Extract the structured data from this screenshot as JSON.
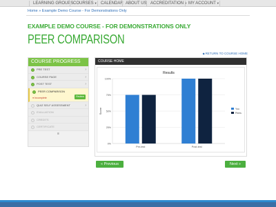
{
  "nav": {
    "items": [
      "LEARNING GROUPS",
      "COURSES",
      "CALENDAR",
      "ABOUT US",
      "ACCREDITATION",
      "MY ACCOUNT"
    ]
  },
  "breadcrumb": {
    "home": "Home",
    "separator": " » ",
    "current": "Example Demo Course - For Demonstrations Only"
  },
  "course_title": "EXAMPLE DEMO COURSE - FOR DEMONSTRATIONS ONLY",
  "page_title": "PEER COMPARISON",
  "return_link": "RETURN TO COURSE HOME",
  "sidebar": {
    "title": "COURSE PROGRESS",
    "items": [
      {
        "label": "PRE TEST",
        "state": "done"
      },
      {
        "label": "COURSE PAGE",
        "state": "done"
      },
      {
        "label": "POST TEST",
        "state": "done"
      },
      {
        "label": "PEER COMPARISON",
        "state": "active",
        "sub": "Incomplete",
        "action": "Review"
      },
      {
        "label": "QUIZ SELF ASSESSMENT",
        "state": "todo"
      },
      {
        "label": "EVALUATION",
        "state": "locked"
      },
      {
        "label": "CREDITS",
        "state": "locked"
      },
      {
        "label": "CERTIFICATE",
        "state": "locked"
      }
    ]
  },
  "main": {
    "header": "COURSE HOME"
  },
  "buttons": {
    "previous": "Previous",
    "next": "Next"
  },
  "colors": {
    "brand_green": "#3aaa35",
    "bar_you": "#2f7fd3",
    "bar_peers": "#0f2340"
  },
  "chart_data": {
    "type": "bar",
    "title": "Results",
    "xlabel": "",
    "ylabel": "Score",
    "categories": [
      "Pre-test",
      "Post-test"
    ],
    "series": [
      {
        "name": "You",
        "values": [
          75,
          100
        ]
      },
      {
        "name": "Peers",
        "values": [
          75,
          100
        ]
      }
    ],
    "ylim": [
      0,
      100
    ],
    "yticks": [
      "0%",
      "25%",
      "50%",
      "75%",
      "100%"
    ],
    "legend_title": "",
    "legend": "right"
  }
}
